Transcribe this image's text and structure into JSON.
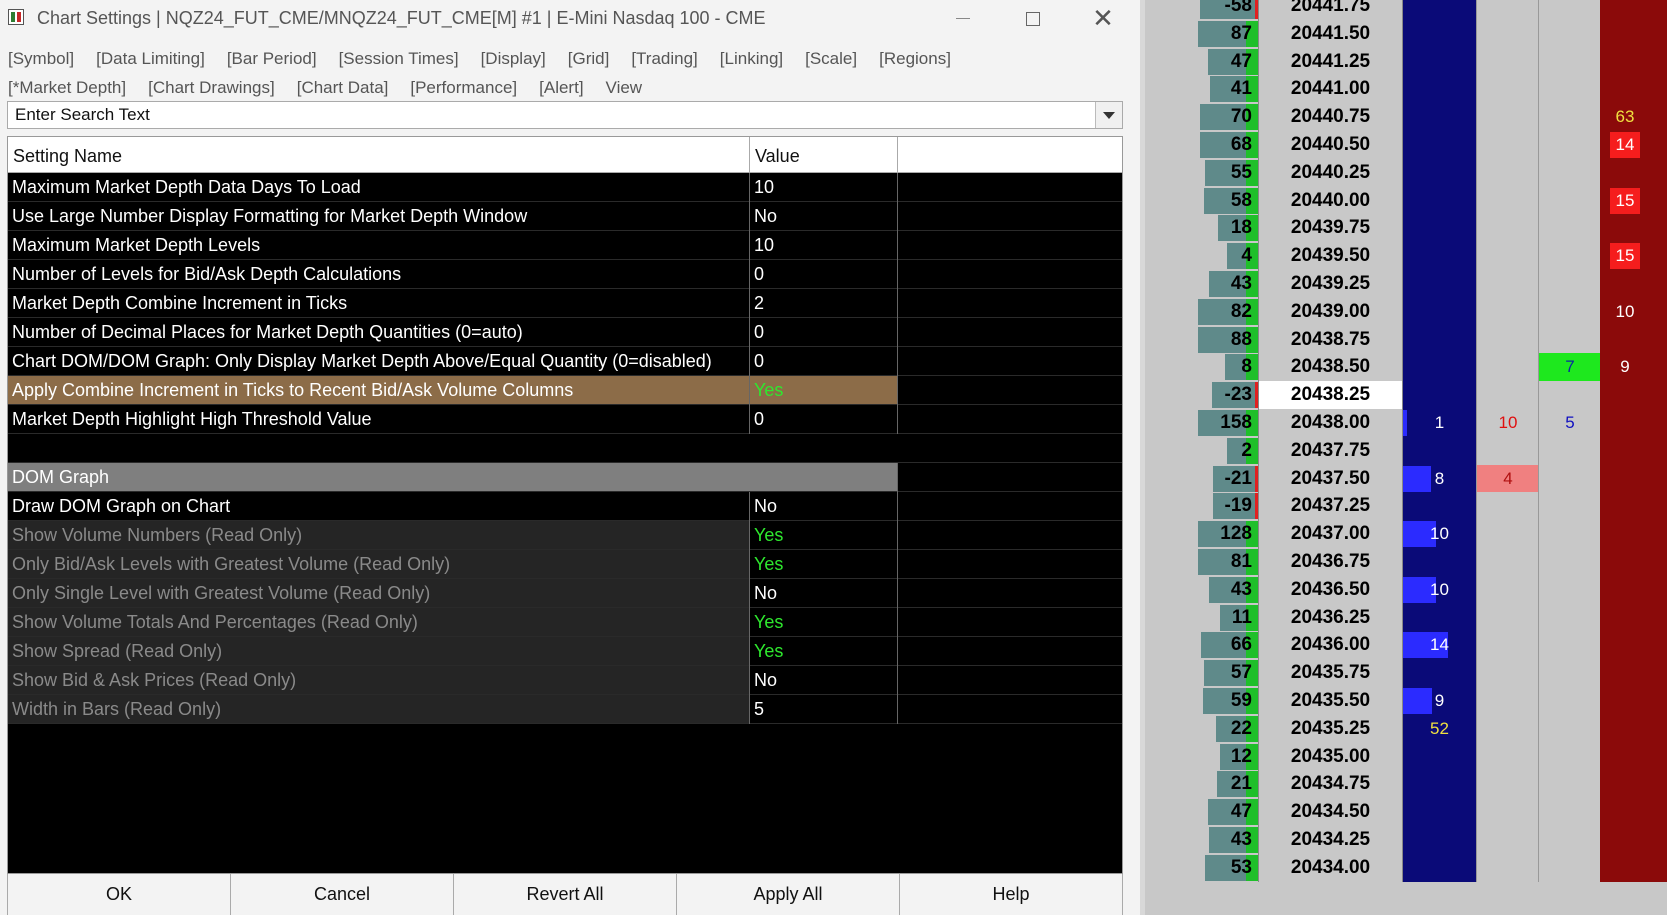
{
  "window": {
    "title": "Chart Settings | NQZ24_FUT_CME/MNQZ24_FUT_CME[M] #1 | E-Mini Nasdaq 100 - CME",
    "minimize_icon": "minimize-icon",
    "maximize_icon": "maximize-icon",
    "close_label": "✕"
  },
  "tabs": {
    "row1": [
      "[Symbol]",
      "[Data Limiting]",
      "[Bar Period]",
      "[Session Times]",
      "[Display]",
      "[Grid]",
      "[Trading]",
      "[Linking]",
      "[Scale]",
      "[Regions]"
    ],
    "row2": [
      "[*Market Depth]",
      "[Chart Drawings]",
      "[Chart Data]",
      "[Performance]",
      "[Alert]",
      "View"
    ]
  },
  "search": {
    "placeholder": "Enter Search Text",
    "value": ""
  },
  "grid": {
    "header_name": "Setting Name",
    "header_value": "Value",
    "rows": [
      {
        "name": "Maximum Market Depth Data Days To Load",
        "value": "10",
        "kind": "normal"
      },
      {
        "name": "Use Large Number Display Formatting for Market Depth Window",
        "value": "No",
        "kind": "normal"
      },
      {
        "name": "Maximum Market Depth Levels",
        "value": "10",
        "kind": "normal"
      },
      {
        "name": "Number of Levels for Bid/Ask Depth Calculations",
        "value": "0",
        "kind": "normal"
      },
      {
        "name": "Market Depth Combine Increment in Ticks",
        "value": "2",
        "kind": "normal"
      },
      {
        "name": "Number of Decimal Places for Market Depth Quantities (0=auto)",
        "value": "0",
        "kind": "normal"
      },
      {
        "name": "Chart DOM/DOM Graph: Only Display Market Depth Above/Equal Quantity (0=disabled)",
        "value": "0",
        "kind": "normal"
      },
      {
        "name": "Apply Combine Increment in Ticks to Recent Bid/Ask Volume Columns",
        "value": "Yes",
        "kind": "selected"
      },
      {
        "name": "Market Depth Highlight High Threshold Value",
        "value": "0",
        "kind": "normal"
      },
      {
        "name": "",
        "value": "",
        "kind": "blank"
      },
      {
        "name": "DOM Graph",
        "value": "",
        "kind": "section"
      },
      {
        "name": "Draw DOM Graph on Chart",
        "value": "No",
        "kind": "normal"
      },
      {
        "name": "Show Volume Numbers (Read Only)",
        "value": "Yes",
        "kind": "readonly"
      },
      {
        "name": "Only Bid/Ask Levels with Greatest Volume (Read Only)",
        "value": "Yes",
        "kind": "readonly"
      },
      {
        "name": "Only Single Level with Greatest Volume (Read Only)",
        "value": "No",
        "kind": "readonly"
      },
      {
        "name": "Show Volume Totals And Percentages (Read Only)",
        "value": "Yes",
        "kind": "readonly"
      },
      {
        "name": "Show Spread (Read Only)",
        "value": "Yes",
        "kind": "readonly"
      },
      {
        "name": "Show Bid & Ask Prices (Read Only)",
        "value": "No",
        "kind": "readonly"
      },
      {
        "name": "Width in Bars (Read Only)",
        "value": "5",
        "kind": "readonly"
      }
    ]
  },
  "buttons": [
    "OK",
    "Cancel",
    "Revert All",
    "Apply All",
    "Help"
  ],
  "colors": {
    "yes_text": "#2ee82e",
    "selected_row": "#8c6c48",
    "section_row": "#7f7f7f",
    "bid_column": "#0a0a78",
    "ask_column": "#8b0a0a"
  },
  "ladder": [
    {
      "vol": "-58",
      "price": "20441.75",
      "edge": "red"
    },
    {
      "vol": "87",
      "price": "20441.50",
      "edge": "green"
    },
    {
      "vol": "47",
      "price": "20441.25",
      "edge": "green"
    },
    {
      "vol": "41",
      "price": "20441.00",
      "edge": "green"
    },
    {
      "vol": "70",
      "price": "20440.75",
      "edge": "green",
      "ask_text": "63",
      "ask_color": "#f0e040"
    },
    {
      "vol": "68",
      "price": "20440.50",
      "edge": "green",
      "ask_chip": "14"
    },
    {
      "vol": "55",
      "price": "20440.25",
      "edge": "green"
    },
    {
      "vol": "58",
      "price": "20440.00",
      "edge": "green",
      "ask_chip": "15"
    },
    {
      "vol": "18",
      "price": "20439.75",
      "edge": "green"
    },
    {
      "vol": "4",
      "price": "20439.50",
      "edge": "green",
      "ask_chip": "15"
    },
    {
      "vol": "43",
      "price": "20439.25",
      "edge": "green"
    },
    {
      "vol": "82",
      "price": "20439.00",
      "edge": "green",
      "ask_text": "10",
      "ask_color": "#ffffff"
    },
    {
      "vol": "88",
      "price": "20438.75",
      "edge": "green"
    },
    {
      "vol": "8",
      "price": "20438.50",
      "edge": "green",
      "g2": "7",
      "g2_bg": "#1ee81e",
      "g2_color": "#0a2aa0",
      "ask_text": "9",
      "ask_color": "#ffffff"
    },
    {
      "vol": "-23",
      "price": "20438.25",
      "edge": "red",
      "current": true
    },
    {
      "vol": "158",
      "price": "20438.00",
      "edge": "green",
      "bid": "1",
      "bid_fill": 0.05,
      "g1": "10",
      "g1_color": "#e01010",
      "g2": "5",
      "g2_color": "#1010c0"
    },
    {
      "vol": "2",
      "price": "20437.75",
      "edge": "green"
    },
    {
      "vol": "-21",
      "price": "20437.50",
      "edge": "red",
      "bid": "8",
      "bid_fill": 0.38,
      "g1": "4",
      "g1_color": "#b01010",
      "g1_bg": "#f08080"
    },
    {
      "vol": "-19",
      "price": "20437.25",
      "edge": "red"
    },
    {
      "vol": "128",
      "price": "20437.00",
      "edge": "green",
      "bid": "10",
      "bid_fill": 0.45
    },
    {
      "vol": "81",
      "price": "20436.75",
      "edge": "green"
    },
    {
      "vol": "43",
      "price": "20436.50",
      "edge": "green",
      "bid": "10",
      "bid_fill": 0.45
    },
    {
      "vol": "11",
      "price": "20436.25",
      "edge": "green"
    },
    {
      "vol": "66",
      "price": "20436.00",
      "edge": "green",
      "bid": "14",
      "bid_fill": 0.62
    },
    {
      "vol": "57",
      "price": "20435.75",
      "edge": "green"
    },
    {
      "vol": "59",
      "price": "20435.50",
      "edge": "green",
      "bid": "9",
      "bid_fill": 0.4
    },
    {
      "vol": "22",
      "price": "20435.25",
      "edge": "green",
      "bid_text": "52",
      "bid_text_color": "#f0e040"
    },
    {
      "vol": "12",
      "price": "20435.00",
      "edge": "green"
    },
    {
      "vol": "21",
      "price": "20434.75",
      "edge": "green"
    },
    {
      "vol": "47",
      "price": "20434.50",
      "edge": "green"
    },
    {
      "vol": "43",
      "price": "20434.25",
      "edge": "green"
    },
    {
      "vol": "53",
      "price": "20434.00",
      "edge": "green"
    }
  ]
}
